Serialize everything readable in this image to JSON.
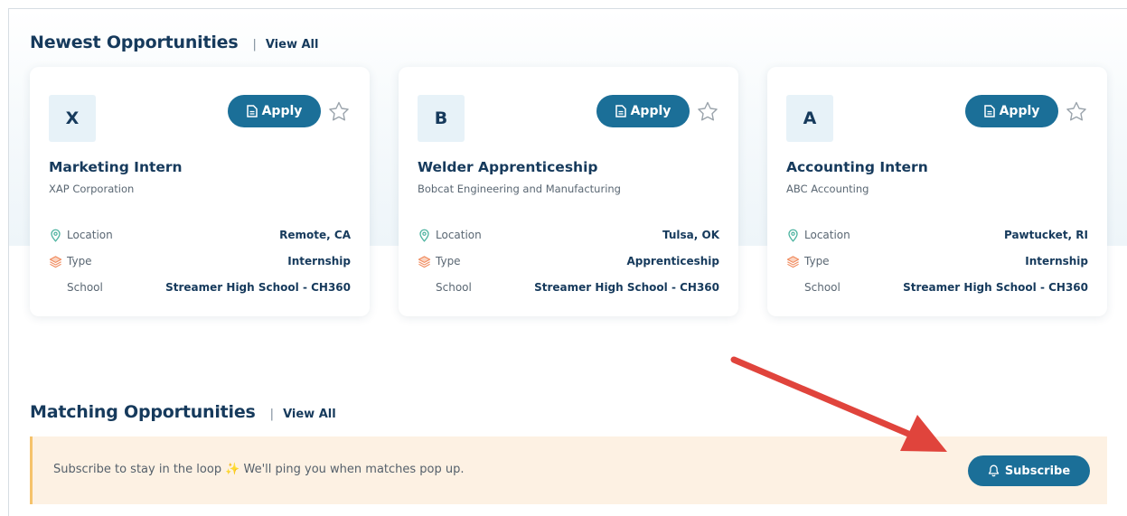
{
  "newest": {
    "title": "Newest Opportunities",
    "separator": "|",
    "view_all": "View All"
  },
  "labels": {
    "apply": "Apply",
    "location": "Location",
    "type": "Type",
    "school": "School"
  },
  "cards": [
    {
      "logo_letter": "X",
      "title": "Marketing Intern",
      "company": "XAP Corporation",
      "location": "Remote, CA",
      "type": "Internship",
      "school": "Streamer High School - CH360"
    },
    {
      "logo_letter": "B",
      "title": "Welder Apprenticeship",
      "company": "Bobcat Engineering and Manufacturing",
      "location": "Tulsa, OK",
      "type": "Apprenticeship",
      "school": "Streamer High School - CH360"
    },
    {
      "logo_letter": "A",
      "title": "Accounting Intern",
      "company": "ABC Accounting",
      "location": "Pawtucket, RI",
      "type": "Internship",
      "school": "Streamer High School - CH360"
    }
  ],
  "matching": {
    "title": "Matching Opportunities",
    "separator": "|",
    "view_all": "View All",
    "banner_text": "Subscribe to stay in the loop ✨ We'll ping you when matches pop up.",
    "subscribe_label": "Subscribe"
  },
  "icons": {
    "apply": "document-icon",
    "favorite": "star-outline-icon",
    "location": "map-pin-icon",
    "type": "layers-icon",
    "subscribe": "bell-icon",
    "annotation": "red-arrow-annotation"
  },
  "colors": {
    "primary": "#1b6f98",
    "heading": "#163a5c",
    "banner_bg": "#fdf1e3",
    "banner_accent": "#f5c36b",
    "location_icon": "#4db3a0",
    "type_icon": "#f08a5d",
    "annotation_arrow": "#e0443c"
  }
}
